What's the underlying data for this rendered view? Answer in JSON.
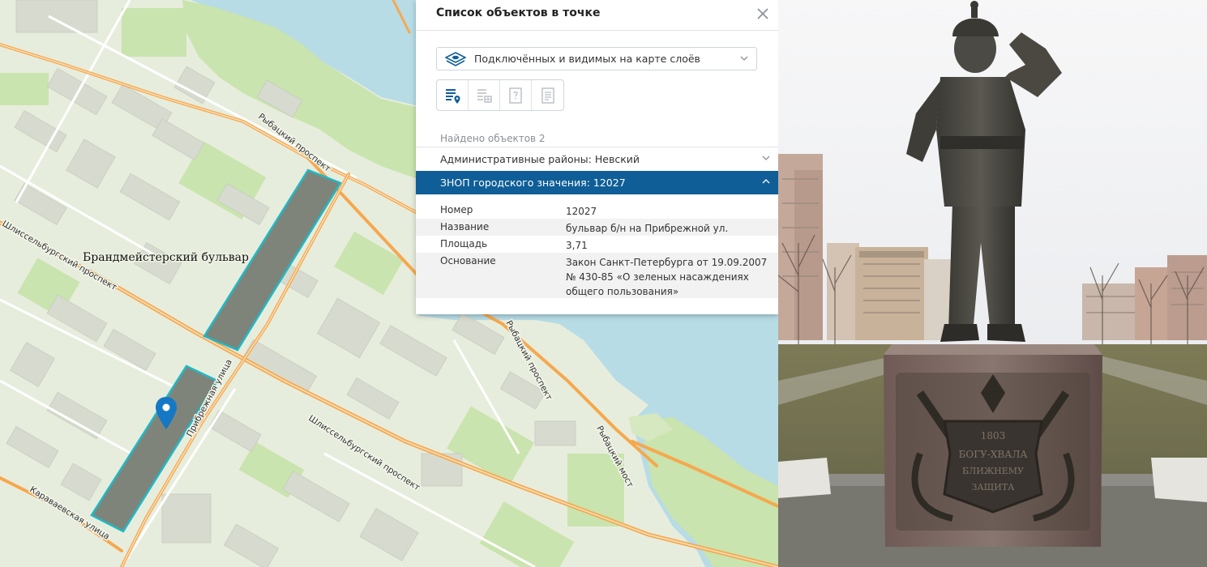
{
  "map": {
    "labels": {
      "rybatsky_top": "Рыбацкий проспект",
      "bulvar": "Брандмейстерский бульвар",
      "shlis_left": "Шлиссельбургский проспект",
      "pribrezhnaya": "Прибрежная улица",
      "shlis_center": "Шлиссельбургский проспект",
      "rybatsky_right": "Рыбацкий проспект",
      "rybatsky_most": "Рыбацкий мост",
      "karavaevskaya": "Караваевская улица"
    },
    "colors": {
      "land": "#e7eddd",
      "green": "#c9e4ae",
      "water": "#b7dce6",
      "building": "#d8dcd0",
      "road_main": "#f6a84e",
      "polygon_fill": "#7f847a",
      "polygon_stroke": "#1fb9c6",
      "marker": "#1478c4"
    },
    "marker_icon": "map-pin-icon"
  },
  "panel": {
    "title": "Список объектов в точке",
    "close_icon": "close-icon",
    "layer_select": {
      "icon": "layers-icon",
      "value": "Подключённых и видимых на карте слоёв"
    },
    "tools": [
      {
        "icon": "list-location-icon",
        "active": true
      },
      {
        "icon": "list-table-icon",
        "active": false
      },
      {
        "icon": "question-document-icon",
        "active": false
      },
      {
        "icon": "document-icon",
        "active": false
      }
    ],
    "found_label": "Найдено объектов 2",
    "accordion": [
      {
        "label": "Административные районы: Невский",
        "expanded": false
      },
      {
        "label": "ЗНОП городского значения: 12027",
        "expanded": true
      }
    ],
    "details": [
      {
        "key": "Номер",
        "value": "12027"
      },
      {
        "key": "Название",
        "value": "бульвар б/н на Прибрежной ул."
      },
      {
        "key": "Площадь",
        "value": "3,71"
      },
      {
        "key": "Основание",
        "value": "Закон Санкт-Петербурга от 19.09.2007 № 430-85 «О зеленых насаждениях общего пользования»"
      }
    ],
    "accent_color": "#0f5e97"
  },
  "photo": {
    "plaque": {
      "year": "1803",
      "line1": "БОГУ-ХВАЛА",
      "line2": "БЛИЖНЕМУ",
      "line3": "ЗАЩИТА"
    }
  }
}
